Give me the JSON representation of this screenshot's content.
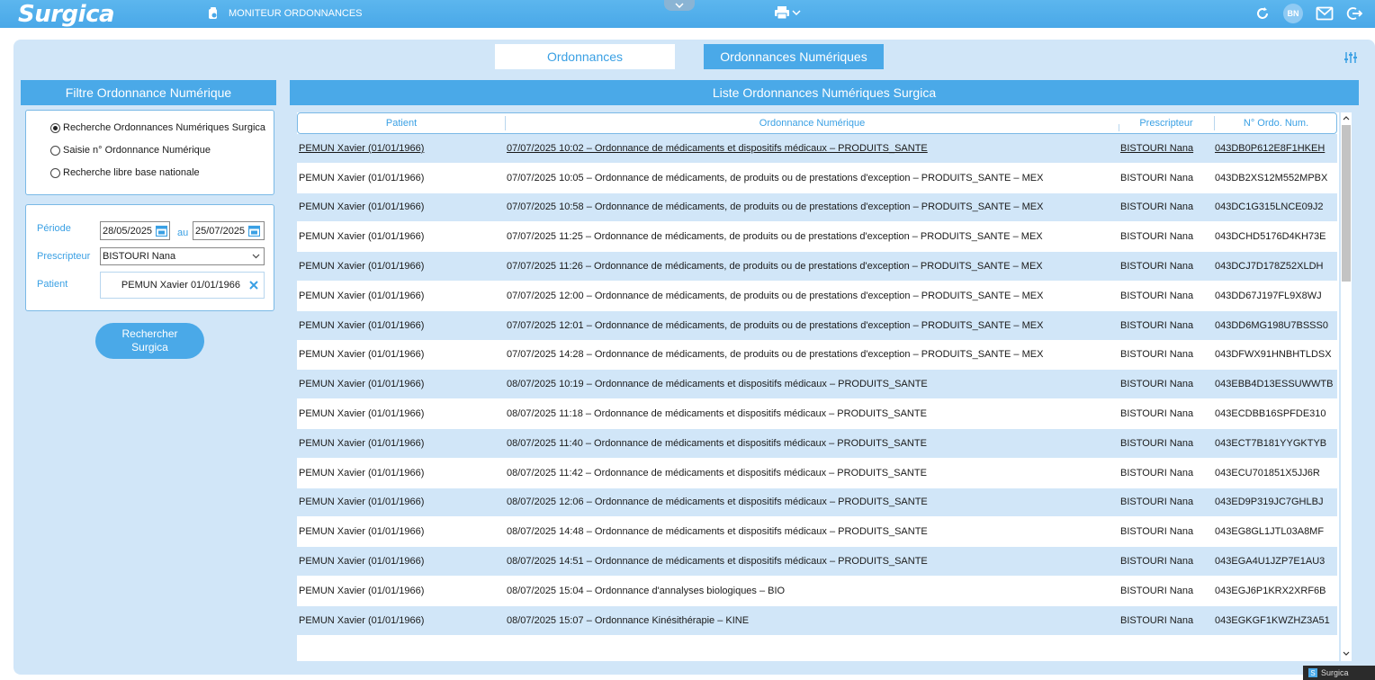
{
  "app": {
    "logo": "Surgica",
    "module_label": "MONITEUR ORDONNANCES",
    "user_initials": "BN"
  },
  "tabs": [
    {
      "label": "Ordonnances",
      "active": false
    },
    {
      "label": "Ordonnances Numériques",
      "active": true
    }
  ],
  "filter": {
    "title": "Filtre Ordonnance Numérique",
    "radios": [
      {
        "label": "Recherche Ordonnances Numériques Surgica",
        "checked": true
      },
      {
        "label": "Saisie n° Ordonnance Numérique",
        "checked": false
      },
      {
        "label": "Recherche libre base nationale",
        "checked": false
      }
    ],
    "periode_label": "Période",
    "date_from": "28/05/2025",
    "au_label": "au",
    "date_to": "25/07/2025",
    "prescripteur_label": "Prescripteur",
    "prescripteur_value": "BISTOURI Nana",
    "patient_label": "Patient",
    "patient_value": "PEMUN Xavier 01/01/1966",
    "search_button_line1": "Rechercher",
    "search_button_line2": "Surgica"
  },
  "list": {
    "title": "Liste Ordonnances Numériques Surgica",
    "columns": [
      "Patient",
      "Ordonnance Numérique",
      "Prescripteur",
      "N° Ordo. Num."
    ],
    "rows": [
      {
        "patient": "PEMUN Xavier (01/01/1966)",
        "ordonnance": "07/07/2025 10:02 – Ordonnance de médicaments et dispositifs médicaux – PRODUITS_SANTE",
        "prescripteur": "BISTOURI Nana",
        "numero": "043DB0P612E8F1HKEH"
      },
      {
        "patient": "PEMUN Xavier (01/01/1966)",
        "ordonnance": "07/07/2025 10:05 – Ordonnance de médicaments, de produits ou de prestations d'exception – PRODUITS_SANTE – MEX",
        "prescripteur": "BISTOURI Nana",
        "numero": "043DB2XS12M552MPBX"
      },
      {
        "patient": "PEMUN Xavier (01/01/1966)",
        "ordonnance": "07/07/2025 10:58 – Ordonnance de médicaments, de produits ou de prestations d'exception – PRODUITS_SANTE – MEX",
        "prescripteur": "BISTOURI Nana",
        "numero": "043DC1G315LNCE09J2"
      },
      {
        "patient": "PEMUN Xavier (01/01/1966)",
        "ordonnance": "07/07/2025 11:25 – Ordonnance de médicaments, de produits ou de prestations d'exception – PRODUITS_SANTE – MEX",
        "prescripteur": "BISTOURI Nana",
        "numero": "043DCHD5176D4KH73E"
      },
      {
        "patient": "PEMUN Xavier (01/01/1966)",
        "ordonnance": "07/07/2025 11:26 – Ordonnance de médicaments, de produits ou de prestations d'exception – PRODUITS_SANTE – MEX",
        "prescripteur": "BISTOURI Nana",
        "numero": "043DCJ7D178Z52XLDH"
      },
      {
        "patient": "PEMUN Xavier (01/01/1966)",
        "ordonnance": "07/07/2025 12:00 – Ordonnance de médicaments, de produits ou de prestations d'exception – PRODUITS_SANTE – MEX",
        "prescripteur": "BISTOURI Nana",
        "numero": "043DD67J197FL9X8WJ"
      },
      {
        "patient": "PEMUN Xavier (01/01/1966)",
        "ordonnance": "07/07/2025 12:01 – Ordonnance de médicaments, de produits ou de prestations d'exception – PRODUITS_SANTE – MEX",
        "prescripteur": "BISTOURI Nana",
        "numero": "043DD6MG198U7BSSS0"
      },
      {
        "patient": "PEMUN Xavier (01/01/1966)",
        "ordonnance": "07/07/2025 14:28 – Ordonnance de médicaments, de produits ou de prestations d'exception – PRODUITS_SANTE – MEX",
        "prescripteur": "BISTOURI Nana",
        "numero": "043DFWX91HNBHTLDSX"
      },
      {
        "patient": "PEMUN Xavier (01/01/1966)",
        "ordonnance": "08/07/2025 10:19 – Ordonnance de médicaments et dispositifs médicaux – PRODUITS_SANTE",
        "prescripteur": "BISTOURI Nana",
        "numero": "043EBB4D13ESSUWWTB"
      },
      {
        "patient": "PEMUN Xavier (01/01/1966)",
        "ordonnance": "08/07/2025 11:18 – Ordonnance de médicaments et dispositifs médicaux – PRODUITS_SANTE",
        "prescripteur": "BISTOURI Nana",
        "numero": "043ECDBB16SPFDE310"
      },
      {
        "patient": "PEMUN Xavier (01/01/1966)",
        "ordonnance": "08/07/2025 11:40 – Ordonnance de médicaments et dispositifs médicaux – PRODUITS_SANTE",
        "prescripteur": "BISTOURI Nana",
        "numero": "043ECT7B181YYGKTYB"
      },
      {
        "patient": "PEMUN Xavier (01/01/1966)",
        "ordonnance": "08/07/2025 11:42 – Ordonnance de médicaments et dispositifs médicaux – PRODUITS_SANTE",
        "prescripteur": "BISTOURI Nana",
        "numero": "043ECU701851X5JJ6R"
      },
      {
        "patient": "PEMUN Xavier (01/01/1966)",
        "ordonnance": "08/07/2025 12:06 – Ordonnance de médicaments et dispositifs médicaux – PRODUITS_SANTE",
        "prescripteur": "BISTOURI Nana",
        "numero": "043ED9P319JC7GHLBJ"
      },
      {
        "patient": "PEMUN Xavier (01/01/1966)",
        "ordonnance": "08/07/2025 14:48 – Ordonnance de médicaments et dispositifs médicaux – PRODUITS_SANTE",
        "prescripteur": "BISTOURI Nana",
        "numero": "043EG8GL1JTL03A8MF"
      },
      {
        "patient": "PEMUN Xavier (01/01/1966)",
        "ordonnance": "08/07/2025 14:51 – Ordonnance de médicaments et dispositifs médicaux – PRODUITS_SANTE",
        "prescripteur": "BISTOURI Nana",
        "numero": "043EGA4U1JZP7E1AU3"
      },
      {
        "patient": "PEMUN Xavier (01/01/1966)",
        "ordonnance": "08/07/2025 15:04 – Ordonnance d'annalyses biologiques – BIO",
        "prescripteur": "BISTOURI Nana",
        "numero": "043EGJ6P1KRX2XRF6B"
      },
      {
        "patient": "PEMUN Xavier (01/01/1966)",
        "ordonnance": "08/07/2025 15:07 – Ordonnance Kinésithérapie – KINE",
        "prescripteur": "BISTOURI Nana",
        "numero": "043EGKGF1KWZHZ3A51"
      }
    ],
    "selected_row": 0
  },
  "taskbar": {
    "label": "Surgica"
  },
  "colors": {
    "accent": "#4aa9e8",
    "panel": "#d1e6f8",
    "topbar": "#49a8e8"
  }
}
